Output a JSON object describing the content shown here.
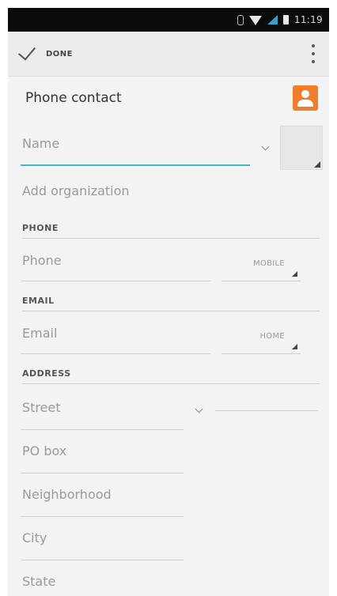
{
  "status_bar": {
    "time": "11:19"
  },
  "action_bar": {
    "done_label": "DONE"
  },
  "account": {
    "label": "Phone contact",
    "accent_color": "#ef7d2b"
  },
  "name_field": {
    "placeholder": "Name"
  },
  "add_organization": "Add organization",
  "phone_section": {
    "header": "PHONE",
    "field_placeholder": "Phone",
    "type_label": "MOBILE"
  },
  "email_section": {
    "header": "EMAIL",
    "field_placeholder": "Email",
    "type_label": "HOME"
  },
  "address_section": {
    "header": "ADDRESS",
    "fields": [
      "Street",
      "PO box",
      "Neighborhood",
      "City",
      "State"
    ]
  },
  "colors": {
    "focus_underline": "#3fb6d6"
  }
}
